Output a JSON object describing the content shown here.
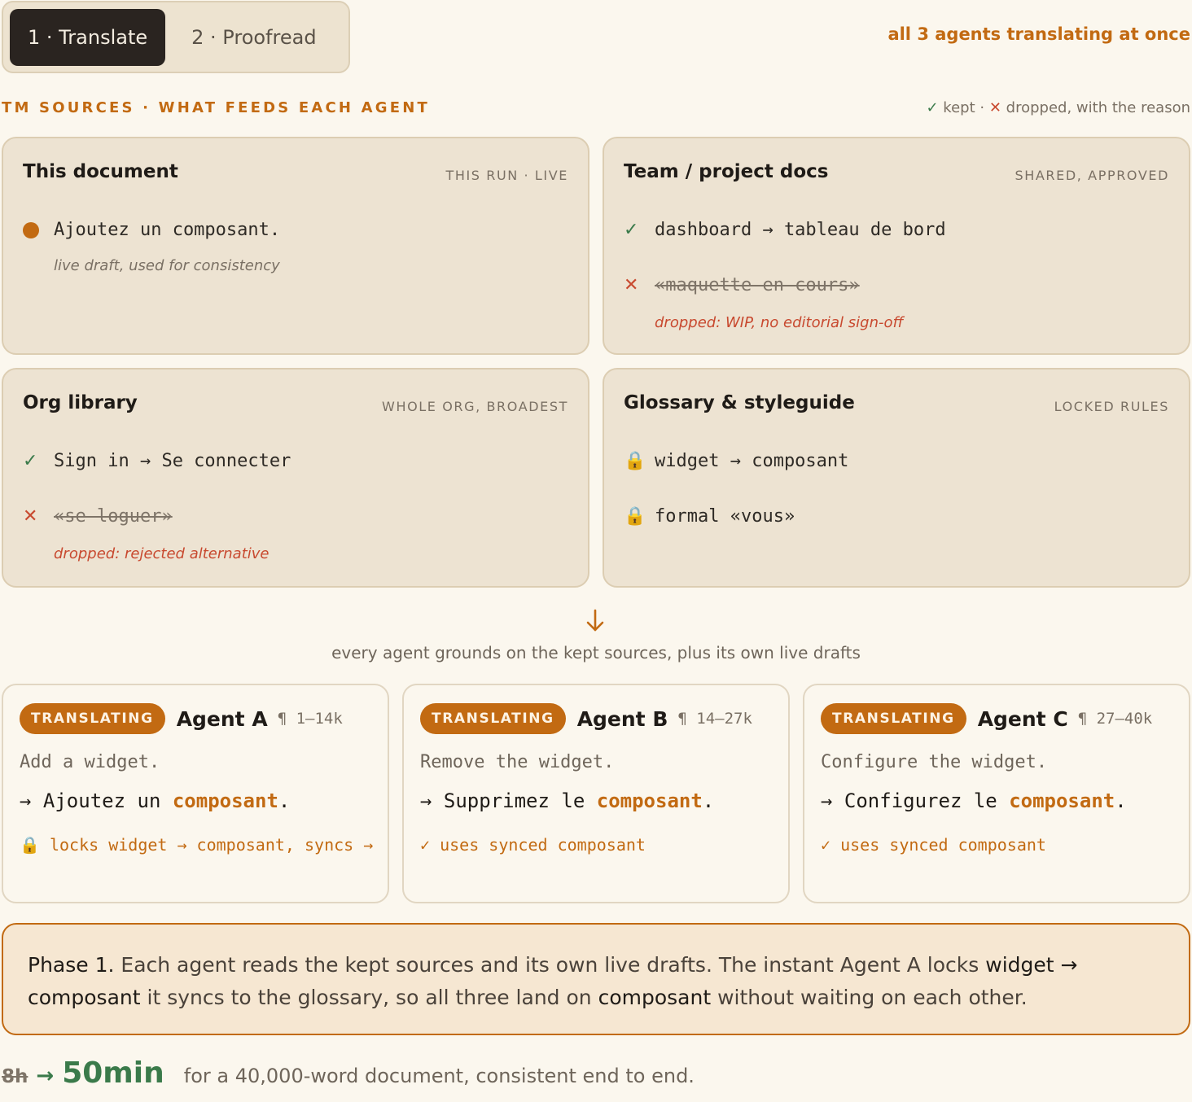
{
  "tabs": [
    {
      "label": "1 · Translate",
      "active": true
    },
    {
      "label": "2 · Proofread",
      "active": false
    }
  ],
  "status_top": "all 3 agents translating at once",
  "section": {
    "title": "TM SOURCES · WHAT FEEDS EACH AGENT",
    "legend_kept_mark": "✓",
    "legend_kept": "kept",
    "legend_sep": "·",
    "legend_dropped_mark": "✕",
    "legend_dropped": "dropped, with the reason"
  },
  "cards": {
    "this_doc": {
      "title": "This document",
      "tag": "THIS RUN · LIVE",
      "entry": "Ajoutez un composant.",
      "note": "live draft, used for consistency"
    },
    "team": {
      "title": "Team / project docs",
      "tag": "SHARED, APPROVED",
      "kept": "dashboard → tableau de bord",
      "dropped": "«maquette en cours»",
      "reason": "dropped: WIP, no editorial sign-off"
    },
    "org": {
      "title": "Org library",
      "tag": "WHOLE ORG, BROADEST",
      "kept": "Sign in → Se connecter",
      "dropped": "«se loguer»",
      "reason": "dropped: rejected alternative"
    },
    "glossary": {
      "title": "Glossary & styleguide",
      "tag": "LOCKED RULES",
      "rule1": "widget → composant",
      "rule2": "formal «vous»"
    }
  },
  "marks": {
    "ok": "✓",
    "x": "✕",
    "lock": "🔒"
  },
  "flow_caption": "every agent grounds on the kept sources, plus its own live drafts",
  "agents": [
    {
      "badge": "TRANSLATING",
      "name": "Agent A",
      "range": "¶ 1–14k",
      "source": "Add a widget.",
      "target_pre": "→ Ajoutez un ",
      "target_term": "composant",
      "target_post": ".",
      "note": "🔒 locks widget → composant, syncs →"
    },
    {
      "badge": "TRANSLATING",
      "name": "Agent B",
      "range": "¶ 14–27k",
      "source": "Remove the widget.",
      "target_pre": "→ Supprimez le ",
      "target_term": "composant",
      "target_post": ".",
      "note": "✓ uses synced composant"
    },
    {
      "badge": "TRANSLATING",
      "name": "Agent C",
      "range": "¶ 27–40k",
      "source": "Configure the widget.",
      "target_pre": "→ Configurez le ",
      "target_term": "composant",
      "target_post": ".",
      "note": "✓ uses synced composant"
    }
  ],
  "phase": {
    "lead": "Phase 1.",
    "t1": " Each agent reads the kept sources and its own live drafts. The instant Agent A locks ",
    "b1": "widget → composant",
    "t2": " it syncs to the glossary, so all three land on ",
    "b2": "composant",
    "t3": " without waiting on each other."
  },
  "stat": {
    "old": "8h",
    "arrow": "→",
    "new": "50min",
    "desc": "for a 40,000-word document, consistent end to end."
  },
  "colors": {
    "accent": "#c26a12",
    "kept": "#3a7a4a",
    "dropped": "#c8492f",
    "background": "#fbf7ee",
    "card": "#ede3d2"
  }
}
